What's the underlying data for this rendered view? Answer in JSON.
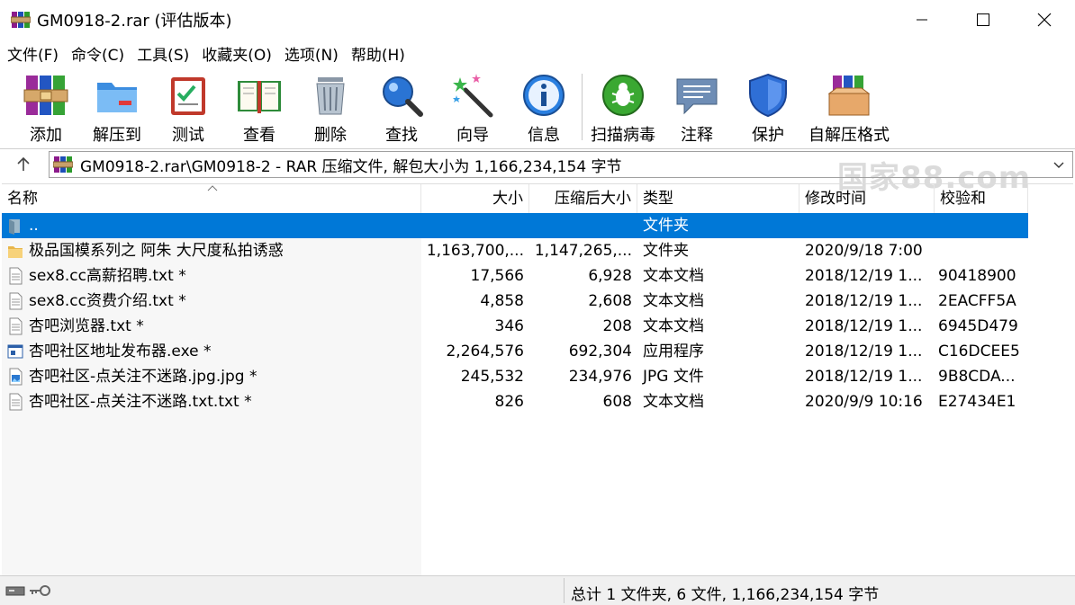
{
  "window": {
    "title": "GM0918-2.rar (评估版本)",
    "controls": [
      "minimize",
      "maximize",
      "close"
    ]
  },
  "menu": [
    {
      "label": "文件(F)"
    },
    {
      "label": "命令(C)"
    },
    {
      "label": "工具(S)"
    },
    {
      "label": "收藏夹(O)"
    },
    {
      "label": "选项(N)"
    },
    {
      "label": "帮助(H)"
    }
  ],
  "toolbar": {
    "buttons": [
      {
        "label": "添加",
        "icon": "archive-books-icon"
      },
      {
        "label": "解压到",
        "icon": "folder-extract-icon"
      },
      {
        "label": "测试",
        "icon": "clipboard-check-icon"
      },
      {
        "label": "查看",
        "icon": "open-book-icon"
      },
      {
        "label": "删除",
        "icon": "trash-can-icon"
      },
      {
        "label": "查找",
        "icon": "magnifier-icon"
      },
      {
        "label": "向导",
        "icon": "magic-wand-icon"
      },
      {
        "label": "信息",
        "icon": "info-icon"
      },
      {
        "label": "扫描病毒",
        "icon": "virus-scan-icon"
      },
      {
        "label": "注释",
        "icon": "comment-icon"
      },
      {
        "label": "保护",
        "icon": "shield-icon"
      },
      {
        "label": "自解压格式",
        "icon": "sfx-box-icon"
      }
    ],
    "watermark": "国家88.com"
  },
  "address": {
    "path": "GM0918-2.rar\\GM0918-2 - RAR 压缩文件, 解包大小为 1,166,234,154 字节"
  },
  "columns": {
    "name": "名称",
    "size": "大小",
    "packed": "压缩后大小",
    "type": "类型",
    "mtime": "修改时间",
    "crc": "校验和"
  },
  "files": [
    {
      "name": "..",
      "size": "",
      "packed": "",
      "type": "文件夹",
      "mtime": "",
      "crc": "",
      "icon": "folder-up-icon",
      "selected": true
    },
    {
      "name": "极品国模系列之 阿朱 大尺度私拍诱惑",
      "size": "1,163,700,...",
      "packed": "1,147,265,...",
      "type": "文件夹",
      "mtime": "2020/9/18 7:00",
      "crc": "",
      "icon": "folder-icon"
    },
    {
      "name": "sex8.cc高薪招聘.txt *",
      "size": "17,566",
      "packed": "6,928",
      "type": "文本文档",
      "mtime": "2018/12/19 1...",
      "crc": "90418900",
      "icon": "text-file-icon"
    },
    {
      "name": "sex8.cc资费介绍.txt *",
      "size": "4,858",
      "packed": "2,608",
      "type": "文本文档",
      "mtime": "2018/12/19 1...",
      "crc": "2EACFF5A",
      "icon": "text-file-icon"
    },
    {
      "name": "杏吧浏览器.txt *",
      "size": "346",
      "packed": "208",
      "type": "文本文档",
      "mtime": "2018/12/19 1...",
      "crc": "6945D479",
      "icon": "text-file-icon"
    },
    {
      "name": "杏吧社区地址发布器.exe *",
      "size": "2,264,576",
      "packed": "692,304",
      "type": "应用程序",
      "mtime": "2018/12/19 1...",
      "crc": "C16DCEE5",
      "icon": "exe-file-icon"
    },
    {
      "name": "杏吧社区-点关注不迷路.jpg.jpg *",
      "size": "245,532",
      "packed": "234,976",
      "type": "JPG 文件",
      "mtime": "2018/12/19 1...",
      "crc": "9B8CDA...",
      "icon": "image-file-icon"
    },
    {
      "name": "杏吧社区-点关注不迷路.txt.txt *",
      "size": "826",
      "packed": "608",
      "type": "文本文档",
      "mtime": "2020/9/9 10:16",
      "crc": "E27434E1",
      "icon": "text-file-icon"
    }
  ],
  "status": {
    "summary": "总计 1 文件夹, 6 文件, 1,166,234,154 字节"
  },
  "colors": {
    "selection": "#0078d7",
    "accent": "#1e5aa8"
  }
}
